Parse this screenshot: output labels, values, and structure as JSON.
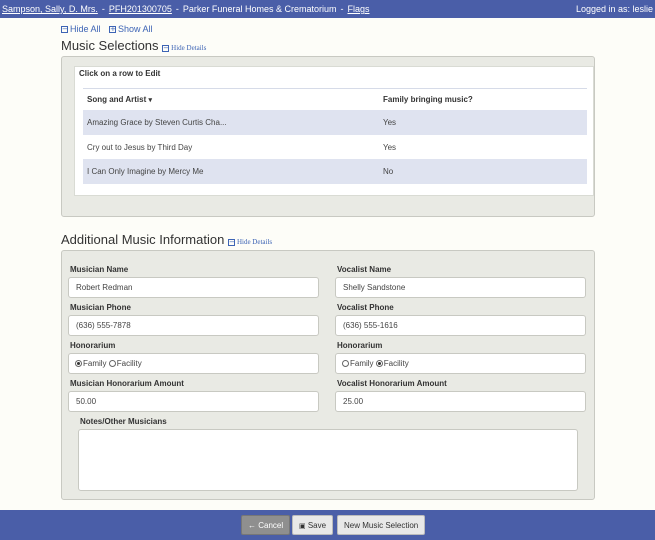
{
  "header": {
    "client_name": "Sampson, Sally, D. Mrs.",
    "case_id": "PFH201300705",
    "company": "Parker Funeral Homes & Crematorium",
    "flags_link": "Flags",
    "separator": "-",
    "logged_in": "Logged in as: leslie"
  },
  "toggles": {
    "hide_all": "Hide All",
    "show_all": "Show All"
  },
  "music_selections": {
    "title": "Music Selections",
    "hide_details": "Hide Details",
    "hint": "Click on a row to Edit",
    "col_song": "Song and Artist",
    "col_family": "Family bringing music?",
    "rows": [
      {
        "song": "Amazing Grace by Steven Curtis Cha...",
        "family": "Yes"
      },
      {
        "song": "Cry out to Jesus by Third Day",
        "family": "Yes"
      },
      {
        "song": "I Can Only Imagine by Mercy Me",
        "family": "No"
      }
    ]
  },
  "additional": {
    "title": "Additional Music Information",
    "hide_details": "Hide Details",
    "musician_name_label": "Musician Name",
    "musician_name": "Robert Redman",
    "vocalist_name_label": "Vocalist Name",
    "vocalist_name": "Shelly Sandstone",
    "musician_phone_label": "Musician Phone",
    "musician_phone": "(636) 555-7878",
    "vocalist_phone_label": "Vocalist Phone",
    "vocalist_phone": "(636) 555-1616",
    "honorarium_label": "Honorarium",
    "option_family": "Family",
    "option_facility": "Facility",
    "musician_honorarium_selected": "Family",
    "vocalist_honorarium_selected": "Facility",
    "musician_amount_label": "Musician Honorarium Amount",
    "musician_amount": "50.00",
    "vocalist_amount_label": "Vocalist Honorarium Amount",
    "vocalist_amount": "25.00",
    "notes_label": "Notes/Other Musicians",
    "notes": ""
  },
  "footer": {
    "cancel": "Cancel",
    "save": "Save",
    "new_selection": "New Music Selection"
  }
}
